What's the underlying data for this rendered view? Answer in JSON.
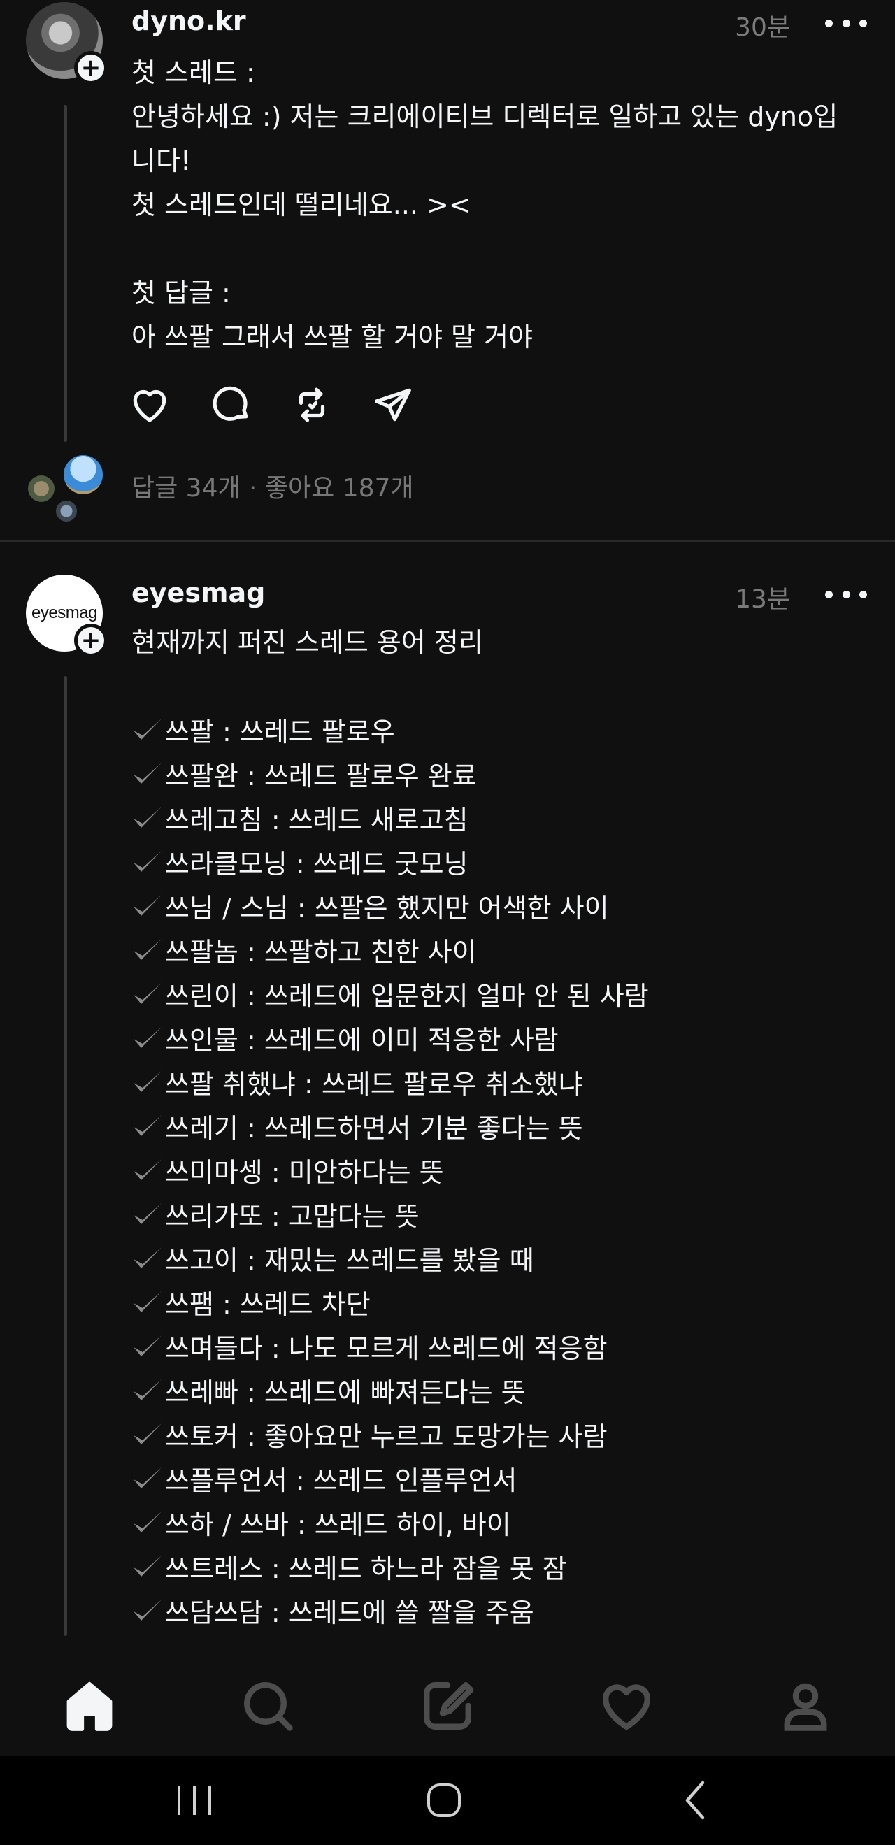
{
  "posts": [
    {
      "username": "dyno.kr",
      "time": "30분",
      "text": "첫 스레드 :\n안녕하세요 :) 저는 크리에이티브 디렉터로 일하고 있는 dyno입\n니다!\n첫 스레드인데 떨리네요... ><\n\n첫 답글 :\n아 쓰팔 그래서 쓰팔 할 거야 말 거야",
      "stats": "답글 34개 · 좋아요 187개",
      "actions": [
        "heart-icon",
        "comment-icon",
        "repost-icon",
        "share-icon"
      ]
    },
    {
      "username": "eyesmag",
      "avatar_text": "eyesmag",
      "time": "13분",
      "intro": "현재까지 퍼진 스레드 용어 정리",
      "terms": [
        "쓰팔 : 쓰레드 팔로우",
        "쓰팔완 : 쓰레드 팔로우 완료",
        "쓰레고침 : 쓰레드 새로고침",
        "쓰라클모닝 : 쓰레드 굿모닝",
        "쓰님 / 스님 : 쓰팔은 했지만 어색한 사이",
        "쓰팔놈 : 쓰팔하고 친한 사이",
        "쓰린이 : 쓰레드에 입문한지 얼마 안 된 사람",
        "쓰인물 : 쓰레드에 이미 적응한 사람",
        "쓰팔 취했냐 : 쓰레드 팔로우 취소했냐",
        "쓰레기 : 쓰레드하면서 기분 좋다는 뜻",
        "쓰미마셍 : 미안하다는 뜻",
        "쓰리가또 : 고맙다는 뜻",
        "쓰고이 : 재밌는 쓰레드를 봤을 때",
        "쓰팸 : 쓰레드 차단",
        "쓰며들다 : 나도 모르게 쓰레드에 적응함",
        "쓰레빠 : 쓰레드에 빠져든다는 뜻",
        "쓰토커 : 좋아요만 누르고 도망가는 사람",
        "쓰플루언서 : 쓰레드 인플루언서",
        "쓰하 / 쓰바 : 쓰레드 하이, 바이",
        "쓰트레스 : 쓰레드 하느라 잠을 못 잠",
        "쓰담쓰담 : 쓰레드에 쓸 짤을 주움"
      ]
    }
  ],
  "bottom_nav": [
    "home-icon",
    "search-icon",
    "compose-icon",
    "activity-heart-icon",
    "profile-icon"
  ],
  "system_nav": [
    "recent-apps-icon",
    "home-circle-icon",
    "back-icon"
  ],
  "colors": {
    "background": "#101010",
    "text": "#f3f5f7",
    "muted": "#777777",
    "thread_line": "#3a3a3a"
  }
}
